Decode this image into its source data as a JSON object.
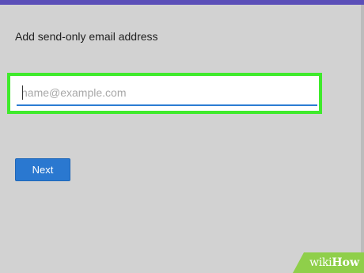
{
  "dialog": {
    "title": "Add send-only email address",
    "email_input": {
      "value": "",
      "placeholder": "name@example.com"
    },
    "next_label": "Next"
  },
  "colors": {
    "accent": "#2a78d0",
    "highlight": "#3fea2c",
    "top_bar": "#5b4fb8",
    "background": "#d2d2d2"
  },
  "watermark": {
    "brand_part1": "wiki",
    "brand_part2": "How"
  }
}
